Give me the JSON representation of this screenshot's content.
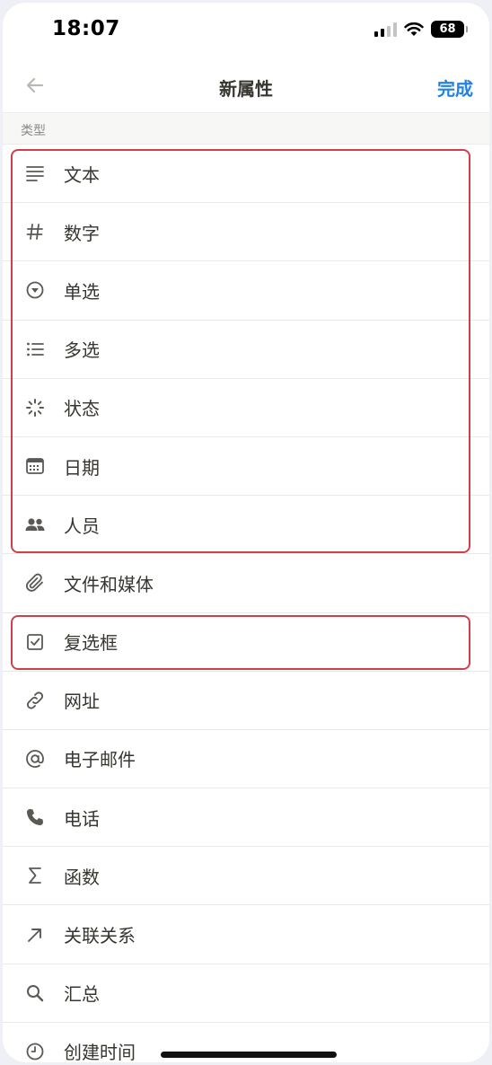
{
  "status_bar": {
    "time": "18:07",
    "battery": "68"
  },
  "nav": {
    "back_icon": "arrow-left-icon",
    "title": "新属性",
    "done_label": "完成"
  },
  "section": {
    "label": "类型"
  },
  "types": [
    {
      "icon": "text-lines-icon",
      "label": "文本"
    },
    {
      "icon": "hash-icon",
      "label": "数字"
    },
    {
      "icon": "circle-chevron-down-icon",
      "label": "单选"
    },
    {
      "icon": "bullet-list-icon",
      "label": "多选"
    },
    {
      "icon": "loading-spinner-icon",
      "label": "状态"
    },
    {
      "icon": "calendar-icon",
      "label": "日期"
    },
    {
      "icon": "people-icon",
      "label": "人员"
    },
    {
      "icon": "paperclip-icon",
      "label": "文件和媒体"
    },
    {
      "icon": "checkbox-icon",
      "label": "复选框"
    },
    {
      "icon": "link-icon",
      "label": "网址"
    },
    {
      "icon": "at-sign-icon",
      "label": "电子邮件"
    },
    {
      "icon": "phone-icon",
      "label": "电话"
    },
    {
      "icon": "sigma-icon",
      "label": "函数"
    },
    {
      "icon": "arrow-up-right-icon",
      "label": "关联关系"
    },
    {
      "icon": "search-icon",
      "label": "汇总"
    },
    {
      "icon": "clock-icon",
      "label": "创建时间"
    }
  ],
  "colors": {
    "accent": "#2383e2",
    "highlight": "#d0404a",
    "text": "#37352f",
    "section_bg": "#f7f7f5"
  }
}
